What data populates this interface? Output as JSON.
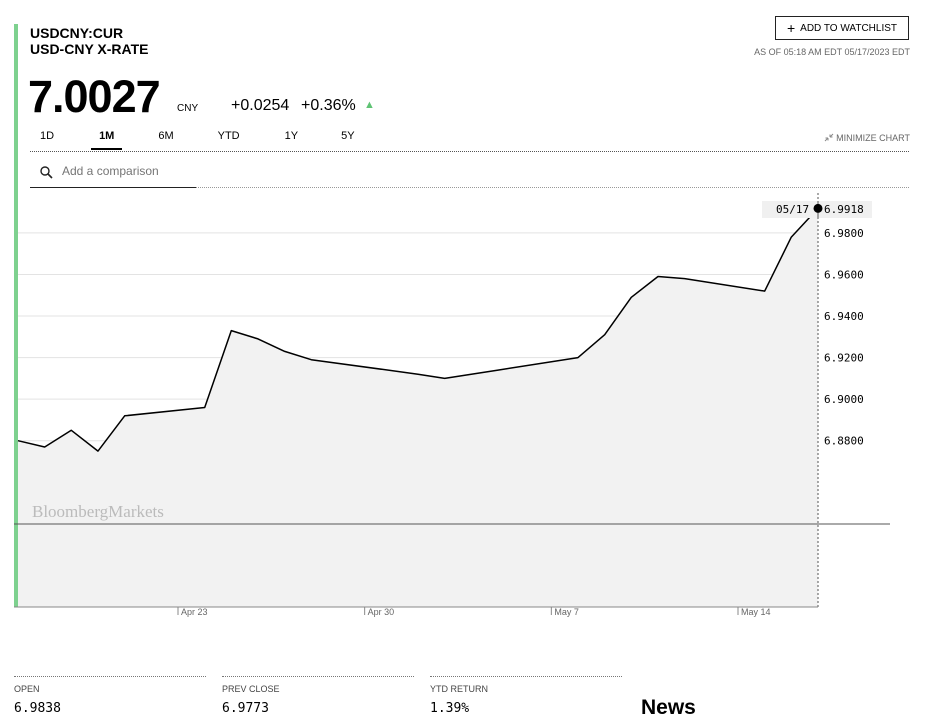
{
  "header": {
    "ticker": "USDCNY:CUR",
    "name": "USD-CNY X-RATE",
    "price": "7.0027",
    "currency": "CNY",
    "change": "+0.0254",
    "change_pct": "+0.36%",
    "as_of": "AS OF 05:18 AM EDT 05/17/2023 EDT",
    "watchlist_label": "ADD TO WATCHLIST",
    "up_color": "#5fc374"
  },
  "range_tabs": [
    "1D",
    "1M",
    "6M",
    "YTD",
    "1Y",
    "5Y"
  ],
  "active_tab": "1M",
  "minimize_label": "MINIMIZE CHART",
  "compare": {
    "placeholder": "Add a comparison"
  },
  "chart_data": {
    "type": "area",
    "watermark": "BloombergMarkets",
    "x_ticks": [
      "Apr 23",
      "Apr 30",
      "May 7",
      "May 14"
    ],
    "y_ticks": [
      "6.8800",
      "6.9000",
      "6.9200",
      "6.9400",
      "6.9600",
      "6.9800"
    ],
    "ylim": [
      6.8,
      6.9992
    ],
    "x": [
      "2023-04-17",
      "2023-04-18",
      "2023-04-19",
      "2023-04-20",
      "2023-04-21",
      "2023-04-24",
      "2023-04-25",
      "2023-04-26",
      "2023-04-27",
      "2023-04-28",
      "2023-05-02",
      "2023-05-03",
      "2023-05-04",
      "2023-05-05",
      "2023-05-08",
      "2023-05-09",
      "2023-05-10",
      "2023-05-11",
      "2023-05-12",
      "2023-05-15",
      "2023-05-16",
      "2023-05-17"
    ],
    "values": [
      6.88,
      6.877,
      6.885,
      6.875,
      6.892,
      6.896,
      6.933,
      6.929,
      6.923,
      6.919,
      6.912,
      6.91,
      6.912,
      6.914,
      6.92,
      6.931,
      6.949,
      6.959,
      6.958,
      6.952,
      6.978,
      6.9918
    ],
    "hover": {
      "date": "05/17",
      "value": "6.9918"
    },
    "line_color": "#000000",
    "fill_color": "#f2f2f2"
  },
  "stats": [
    {
      "label": "OPEN",
      "value": "6.9838"
    },
    {
      "label": "PREV CLOSE",
      "value": "6.9773"
    },
    {
      "label": "YTD RETURN",
      "value": "1.39%"
    }
  ],
  "news_heading": "News"
}
